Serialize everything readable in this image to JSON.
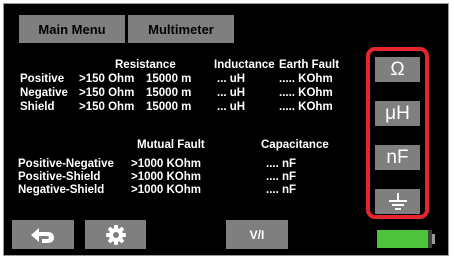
{
  "header": {
    "tab_main_menu": "Main Menu",
    "tab_multimeter": "Multimeter"
  },
  "resistance_section": {
    "col_resistance": "Resistance",
    "col_inductance": "Inductance",
    "col_earth_fault": "Earth Fault",
    "rows": [
      {
        "label": "Positive",
        "resistance": ">150 Ohm",
        "distance": "15000 m",
        "inductance": "... uH",
        "earth_fault": "..... KOhm"
      },
      {
        "label": "Negative",
        "resistance": ">150 Ohm",
        "distance": "15000 m",
        "inductance": "... uH",
        "earth_fault": "..... KOhm"
      },
      {
        "label": "Shield",
        "resistance": ">150 Ohm",
        "distance": "15000 m",
        "inductance": "... uH",
        "earth_fault": "..... KOhm"
      }
    ]
  },
  "mutual_section": {
    "col_mutual_fault": "Mutual Fault",
    "col_capacitance": "Capacitance",
    "rows": [
      {
        "label": "Positive-Negative",
        "mutual_fault": ">1000 KOhm",
        "capacitance": ".... nF"
      },
      {
        "label": "Positive-Shield",
        "mutual_fault": ">1000 KOhm",
        "capacitance": ".... nF"
      },
      {
        "label": "Negative-Shield",
        "mutual_fault": ">1000 KOhm",
        "capacitance": ".... nF"
      }
    ]
  },
  "mode_buttons": [
    {
      "label": "Ω",
      "icon": "ohm-icon"
    },
    {
      "label": "μH",
      "icon": "microhenry-icon"
    },
    {
      "label": "nF",
      "icon": "nanofarad-icon"
    },
    {
      "label": "",
      "icon": "ground-icon"
    }
  ],
  "bottom_bar": {
    "back_icon": "back-arrow-icon",
    "settings_icon": "gear-icon",
    "vi_label": "V/I"
  },
  "battery": {
    "level": 0.92,
    "color": "#4ec13d"
  },
  "colors": {
    "highlight": "#e3262e",
    "button": "#7f7f7f",
    "background": "#000000",
    "text": "#ffffff"
  }
}
